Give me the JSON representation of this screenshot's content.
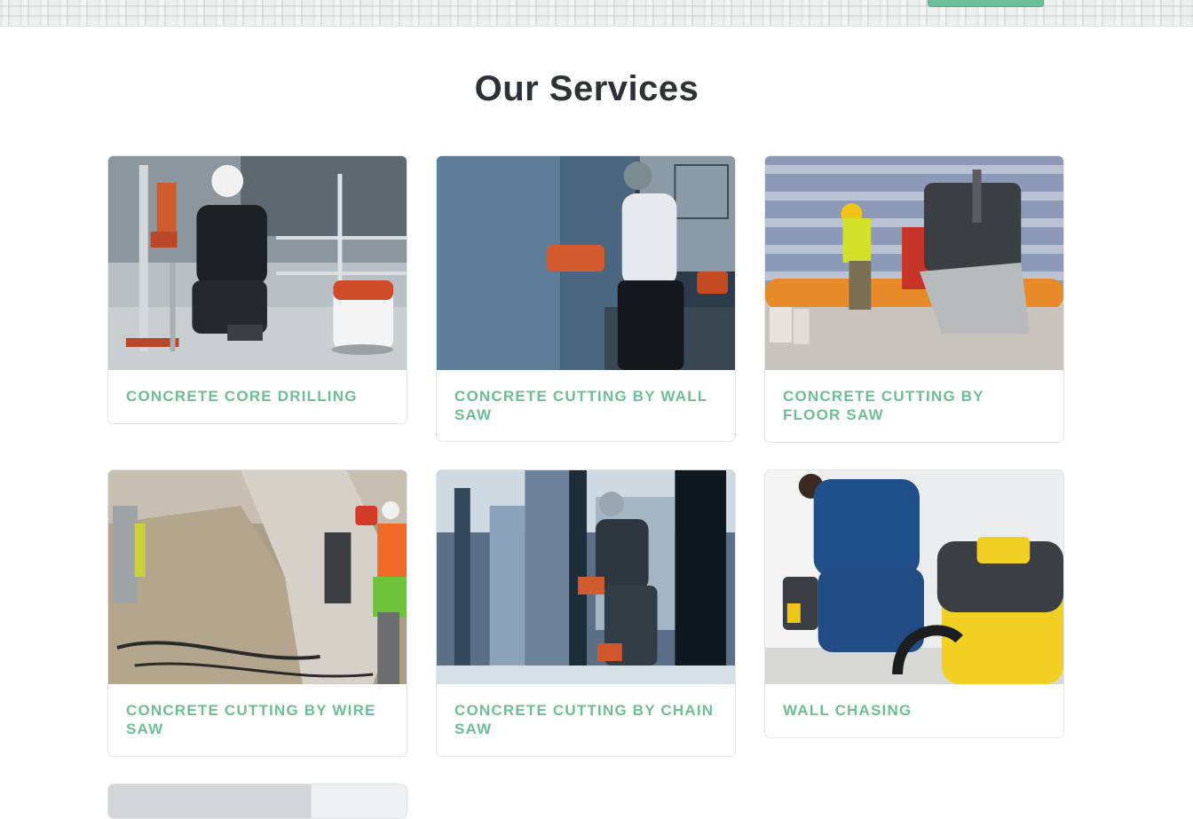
{
  "section": {
    "title": "Our Services"
  },
  "services": [
    {
      "title": "CONCRETE CORE DRILLING",
      "image": "core-drilling-photo"
    },
    {
      "title": "CONCRETE CUTTING BY WALL SAW",
      "image": "wall-saw-photo"
    },
    {
      "title": "CONCRETE CUTTING BY FLOOR SAW",
      "image": "floor-saw-photo"
    },
    {
      "title": "CONCRETE CUTTING BY WIRE SAW",
      "image": "wire-saw-photo"
    },
    {
      "title": "CONCRETE CUTTING BY CHAIN SAW",
      "image": "chain-saw-photo"
    },
    {
      "title": "WALL CHASING",
      "image": "wall-chasing-photo"
    }
  ],
  "colors": {
    "accent": "#6dbf98",
    "title": "#2e3236",
    "card_border": "#e3e5e6"
  }
}
